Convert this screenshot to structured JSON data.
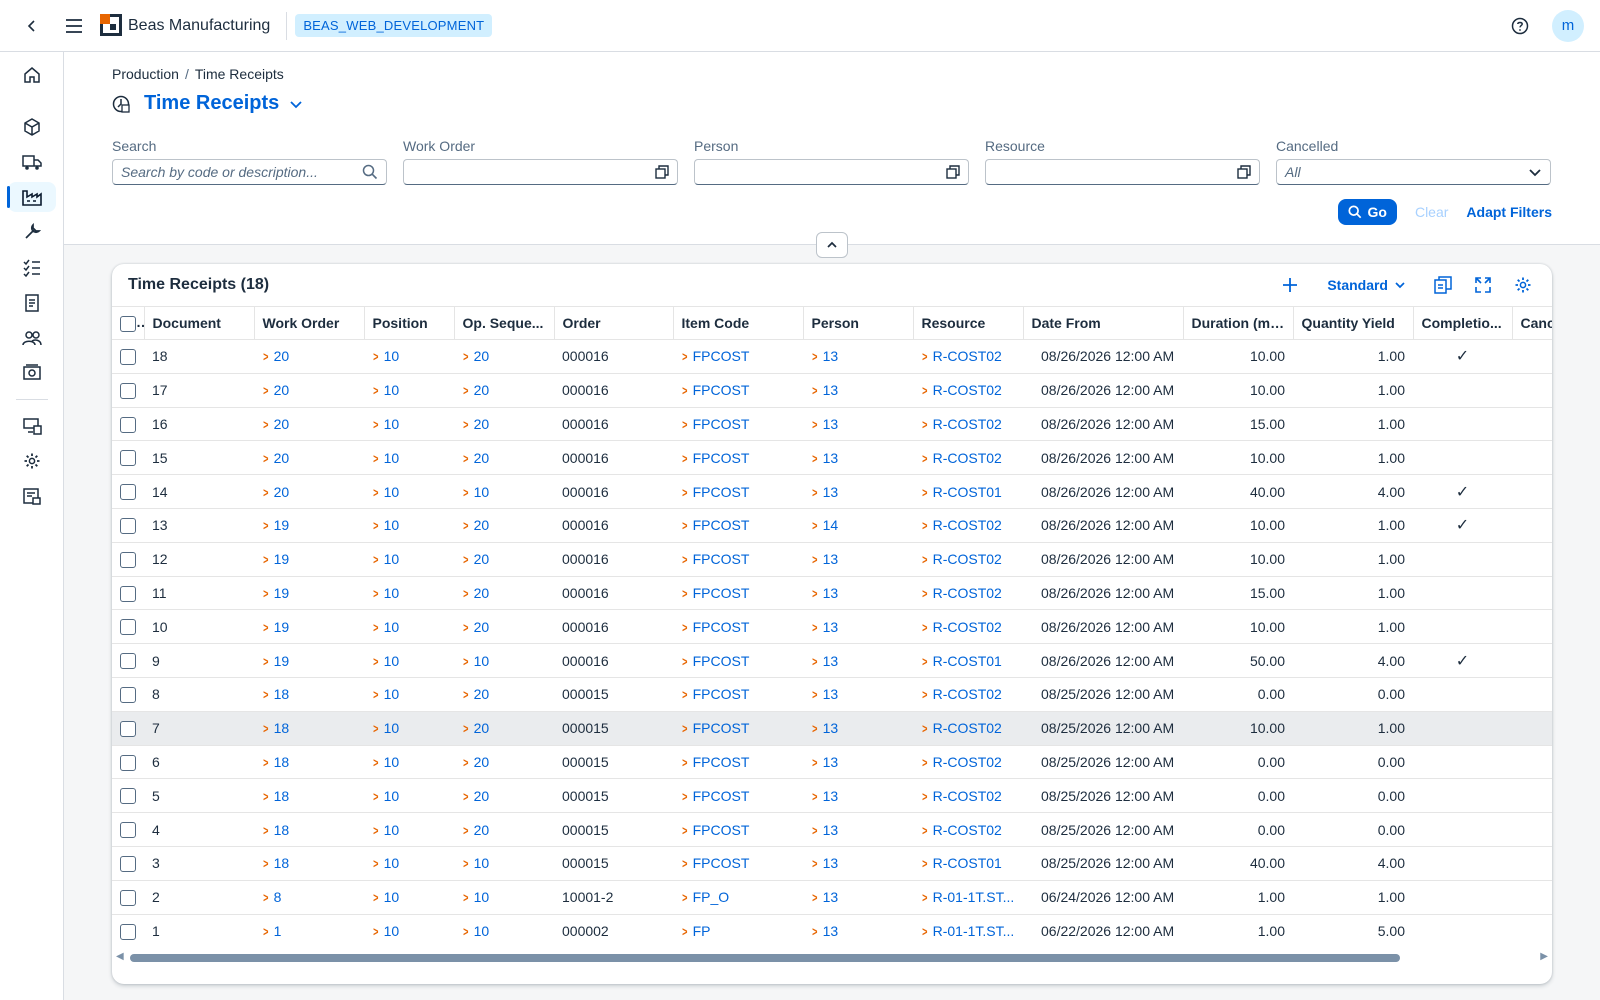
{
  "shell": {
    "app_name": "Beas Manufacturing",
    "system": "BEAS_WEB_DEVELOPMENT",
    "user_initial": "m"
  },
  "breadcrumb": {
    "parent": "Production",
    "separator": "/",
    "current": "Time Receipts"
  },
  "page": {
    "title": "Time Receipts"
  },
  "filters": {
    "search": {
      "label": "Search",
      "placeholder": "Search by code or description..."
    },
    "work_order": {
      "label": "Work Order",
      "value": ""
    },
    "person": {
      "label": "Person",
      "value": ""
    },
    "resource": {
      "label": "Resource",
      "value": ""
    },
    "cancelled": {
      "label": "Cancelled",
      "value": "All"
    },
    "go_label": "Go",
    "clear_label": "Clear",
    "adapt_label": "Adapt Filters"
  },
  "table": {
    "title": "Time Receipts (18)",
    "variant": "Standard",
    "columns": [
      "Document",
      "Work Order",
      "Position",
      "Op. Seque...",
      "Order",
      "Item Code",
      "Person",
      "Resource",
      "Date From",
      "Duration (min)",
      "Quantity Yield",
      "Completio...",
      "Canc"
    ],
    "rows": [
      {
        "doc": "18",
        "wo": "20",
        "pos": "10",
        "op": "20",
        "order": "000016",
        "item": "FPCOST",
        "person": "13",
        "res": "R-COST02",
        "date": "08/26/2026 12:00 AM",
        "dur": "10.00",
        "qty": "1.00",
        "done": "✓"
      },
      {
        "doc": "17",
        "wo": "20",
        "pos": "10",
        "op": "20",
        "order": "000016",
        "item": "FPCOST",
        "person": "13",
        "res": "R-COST02",
        "date": "08/26/2026 12:00 AM",
        "dur": "10.00",
        "qty": "1.00",
        "done": ""
      },
      {
        "doc": "16",
        "wo": "20",
        "pos": "10",
        "op": "20",
        "order": "000016",
        "item": "FPCOST",
        "person": "13",
        "res": "R-COST02",
        "date": "08/26/2026 12:00 AM",
        "dur": "15.00",
        "qty": "1.00",
        "done": ""
      },
      {
        "doc": "15",
        "wo": "20",
        "pos": "10",
        "op": "20",
        "order": "000016",
        "item": "FPCOST",
        "person": "13",
        "res": "R-COST02",
        "date": "08/26/2026 12:00 AM",
        "dur": "10.00",
        "qty": "1.00",
        "done": ""
      },
      {
        "doc": "14",
        "wo": "20",
        "pos": "10",
        "op": "10",
        "order": "000016",
        "item": "FPCOST",
        "person": "13",
        "res": "R-COST01",
        "date": "08/26/2026 12:00 AM",
        "dur": "40.00",
        "qty": "4.00",
        "done": "✓"
      },
      {
        "doc": "13",
        "wo": "19",
        "pos": "10",
        "op": "20",
        "order": "000016",
        "item": "FPCOST",
        "person": "14",
        "res": "R-COST02",
        "date": "08/26/2026 12:00 AM",
        "dur": "10.00",
        "qty": "1.00",
        "done": "✓"
      },
      {
        "doc": "12",
        "wo": "19",
        "pos": "10",
        "op": "20",
        "order": "000016",
        "item": "FPCOST",
        "person": "13",
        "res": "R-COST02",
        "date": "08/26/2026 12:00 AM",
        "dur": "10.00",
        "qty": "1.00",
        "done": ""
      },
      {
        "doc": "11",
        "wo": "19",
        "pos": "10",
        "op": "20",
        "order": "000016",
        "item": "FPCOST",
        "person": "13",
        "res": "R-COST02",
        "date": "08/26/2026 12:00 AM",
        "dur": "15.00",
        "qty": "1.00",
        "done": ""
      },
      {
        "doc": "10",
        "wo": "19",
        "pos": "10",
        "op": "20",
        "order": "000016",
        "item": "FPCOST",
        "person": "13",
        "res": "R-COST02",
        "date": "08/26/2026 12:00 AM",
        "dur": "10.00",
        "qty": "1.00",
        "done": ""
      },
      {
        "doc": "9",
        "wo": "19",
        "pos": "10",
        "op": "10",
        "order": "000016",
        "item": "FPCOST",
        "person": "13",
        "res": "R-COST01",
        "date": "08/26/2026 12:00 AM",
        "dur": "50.00",
        "qty": "4.00",
        "done": "✓"
      },
      {
        "doc": "8",
        "wo": "18",
        "pos": "10",
        "op": "20",
        "order": "000015",
        "item": "FPCOST",
        "person": "13",
        "res": "R-COST02",
        "date": "08/25/2026 12:00 AM",
        "dur": "0.00",
        "qty": "0.00",
        "done": ""
      },
      {
        "doc": "7",
        "wo": "18",
        "pos": "10",
        "op": "20",
        "order": "000015",
        "item": "FPCOST",
        "person": "13",
        "res": "R-COST02",
        "date": "08/25/2026 12:00 AM",
        "dur": "10.00",
        "qty": "1.00",
        "done": ""
      },
      {
        "doc": "6",
        "wo": "18",
        "pos": "10",
        "op": "20",
        "order": "000015",
        "item": "FPCOST",
        "person": "13",
        "res": "R-COST02",
        "date": "08/25/2026 12:00 AM",
        "dur": "0.00",
        "qty": "0.00",
        "done": ""
      },
      {
        "doc": "5",
        "wo": "18",
        "pos": "10",
        "op": "20",
        "order": "000015",
        "item": "FPCOST",
        "person": "13",
        "res": "R-COST02",
        "date": "08/25/2026 12:00 AM",
        "dur": "0.00",
        "qty": "0.00",
        "done": ""
      },
      {
        "doc": "4",
        "wo": "18",
        "pos": "10",
        "op": "20",
        "order": "000015",
        "item": "FPCOST",
        "person": "13",
        "res": "R-COST02",
        "date": "08/25/2026 12:00 AM",
        "dur": "0.00",
        "qty": "0.00",
        "done": ""
      },
      {
        "doc": "3",
        "wo": "18",
        "pos": "10",
        "op": "10",
        "order": "000015",
        "item": "FPCOST",
        "person": "13",
        "res": "R-COST01",
        "date": "08/25/2026 12:00 AM",
        "dur": "40.00",
        "qty": "4.00",
        "done": ""
      },
      {
        "doc": "2",
        "wo": "8",
        "pos": "10",
        "op": "10",
        "order": "10001-2",
        "item": "FP_O",
        "person": "13",
        "res": "R-01-1T.ST...",
        "date": "06/24/2026 12:00 AM",
        "dur": "1.00",
        "qty": "1.00",
        "done": ""
      },
      {
        "doc": "1",
        "wo": "1",
        "pos": "10",
        "op": "10",
        "order": "000002",
        "item": "FP",
        "person": "13",
        "res": "R-01-1T.ST...",
        "date": "06/22/2026 12:00 AM",
        "dur": "1.00",
        "qty": "5.00",
        "done": ""
      }
    ],
    "highlighted_row": 11
  },
  "icons": {
    "back": "back-icon",
    "menu": "hamburger-icon",
    "help": "help-icon",
    "nav": [
      "home-icon",
      "products-icon",
      "shipping-icon",
      "production-icon",
      "tools-icon",
      "checklist-icon",
      "document-icon",
      "people-icon",
      "cost-icon",
      "resource-icon",
      "settings-icon",
      "report-icon"
    ]
  },
  "colors": {
    "brand": "#0064d9",
    "link_chevron": "#e76500",
    "badge_bg": "#d1efff"
  }
}
